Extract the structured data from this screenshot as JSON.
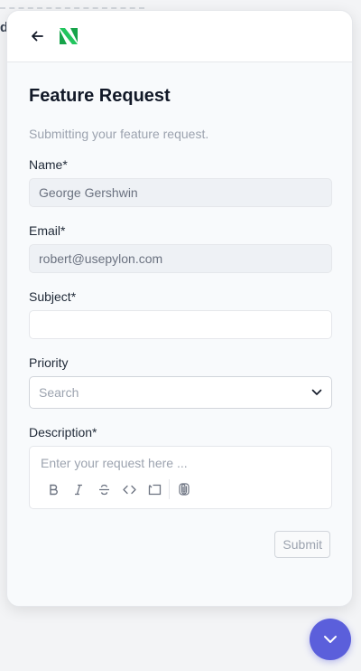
{
  "background": {
    "partial_text": "d"
  },
  "header": {
    "back_icon": "arrow-left-icon",
    "logo": "pylon-logo"
  },
  "form": {
    "title": "Feature Request",
    "subtitle": "Submitting your feature request.",
    "name": {
      "label": "Name*",
      "value": "George Gershwin"
    },
    "email": {
      "label": "Email*",
      "value": "robert@usepylon.com"
    },
    "subject": {
      "label": "Subject*",
      "value": ""
    },
    "priority": {
      "label": "Priority",
      "placeholder": "Search"
    },
    "description": {
      "label": "Description*",
      "placeholder": "Enter your request here ...",
      "toolbar": [
        "bold-icon",
        "italic-icon",
        "strikethrough-icon",
        "code-icon",
        "code-block-icon",
        "attachment-icon"
      ]
    },
    "submit_label": "Submit"
  },
  "fab": {
    "icon": "chevron-down-icon",
    "color": "#5b5fdb"
  },
  "colors": {
    "logo_green": "#22c55e",
    "logo_dark": "#16a34a"
  }
}
